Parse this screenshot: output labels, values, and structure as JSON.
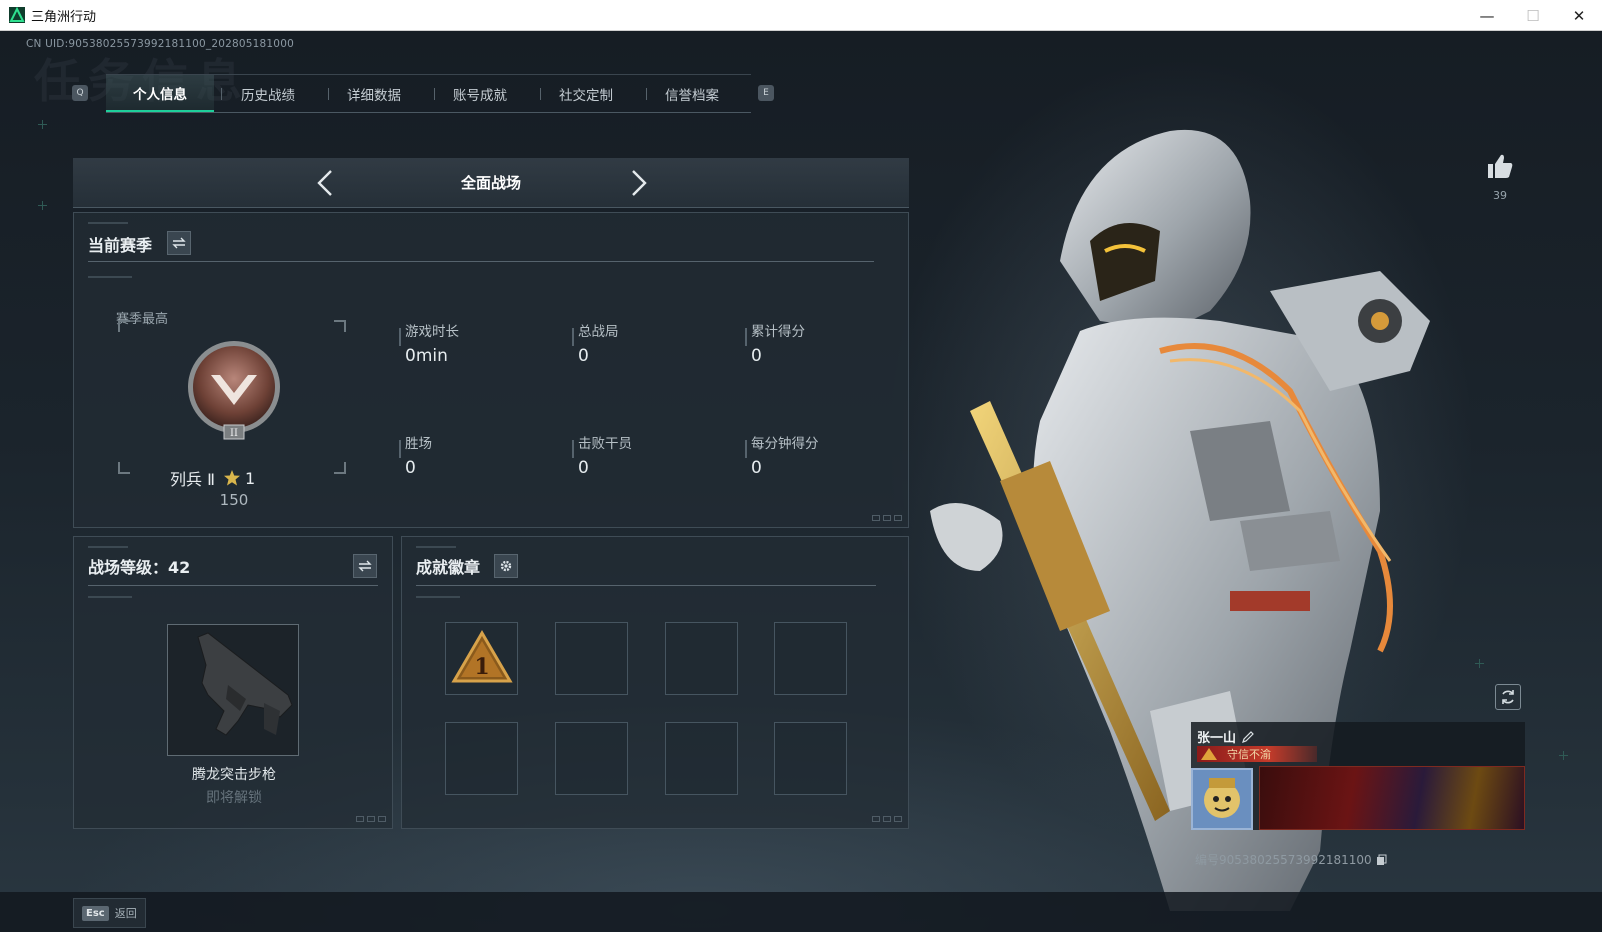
{
  "window": {
    "title": "三角洲行动",
    "minimize": "—",
    "maximize": "☐",
    "close": "✕"
  },
  "uid": "CN UID:9053802557399218110​0_202805181000",
  "background_title": "任务信息",
  "tabs": {
    "left_key": "Q",
    "right_key": "E",
    "items": [
      {
        "label": "个人信息",
        "active": true
      },
      {
        "label": "历史战绩",
        "active": false
      },
      {
        "label": "详细数据",
        "active": false
      },
      {
        "label": "账号成就",
        "active": false
      },
      {
        "label": "社交定制",
        "active": false
      },
      {
        "label": "信誉档案",
        "active": false
      }
    ]
  },
  "mode": {
    "title": "全面战场"
  },
  "season": {
    "title": "当前赛季",
    "best_label": "赛季最高",
    "rank_name": "列兵 Ⅱ",
    "stars": "1",
    "rank_score": "150",
    "stats": [
      {
        "label": "游戏时长",
        "value": "0min"
      },
      {
        "label": "总战局",
        "value": "0"
      },
      {
        "label": "累计得分",
        "value": "0"
      },
      {
        "label": "胜场",
        "value": "0"
      },
      {
        "label": "击败干员",
        "value": "0"
      },
      {
        "label": "每分钟得分",
        "value": "0"
      }
    ]
  },
  "battlefield_level": {
    "title": "战场等级：42",
    "weapon_name": "腾龙突击步枪",
    "weapon_status": "即将解锁"
  },
  "achievements": {
    "title": "成就徽章",
    "first_badge_number": "1"
  },
  "likes": {
    "count": "39"
  },
  "namecard": {
    "name": "张一山",
    "title_badge": "守信不渝",
    "id_text": "编号9053802557399218110​0"
  },
  "footer": {
    "esc_key": "Esc",
    "esc_label": "返回"
  },
  "colors": {
    "accent": "#1ecf9b",
    "background": "#1b242c",
    "panel": "#222c34"
  }
}
